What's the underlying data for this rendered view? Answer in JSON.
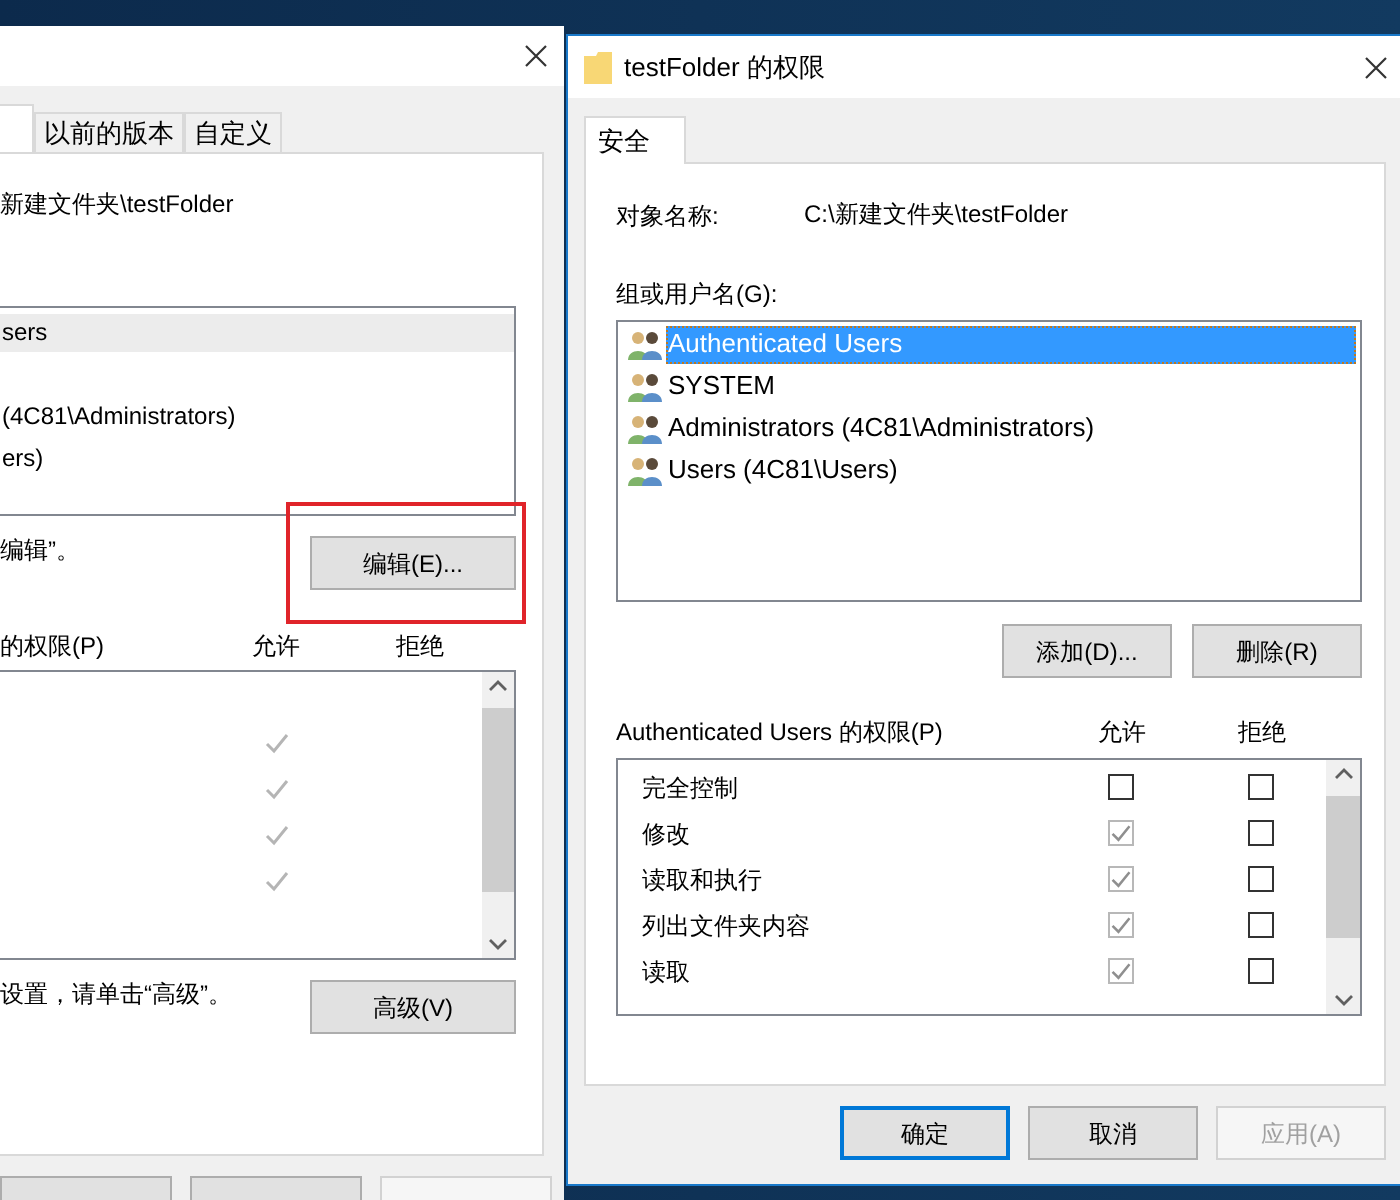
{
  "background_window": {
    "tabs": [
      {
        "selected": true
      },
      {
        "label": "以前的版本",
        "selected": false
      },
      {
        "label": "自定义",
        "selected": false
      }
    ],
    "object_path": "新建文件夹\\testFolder",
    "groups": [
      {
        "name": "sers",
        "selected": true
      },
      {
        "selected": false
      },
      {
        "name": "(4C81\\Administrators)",
        "selected": false
      },
      {
        "name": "ers)",
        "selected": false
      }
    ],
    "edit_hint": "编辑”。",
    "edit_button": {
      "label": "编辑(E)...",
      "highlighted": true
    },
    "permissions_header": "的权限(P)",
    "allow_header": "允许",
    "deny_header": "拒绝",
    "permissions": [
      {
        "allow": false
      },
      {
        "allow": true
      },
      {
        "allow": true
      },
      {
        "allow": true
      },
      {
        "allow": true
      }
    ],
    "advanced_hint": "设置，请单击“高级”。",
    "advanced_button": "高级(V)",
    "footer_buttons": [
      {
        "disabled": false
      },
      {
        "disabled": false
      },
      {
        "disabled": true
      }
    ]
  },
  "foreground_window": {
    "title": "testFolder 的权限",
    "tabs": [
      {
        "label": "安全",
        "selected": true
      }
    ],
    "object_name_label": "对象名称:",
    "object_name": "C:\\新建文件夹\\testFolder",
    "groups_label": "组或用户名(G):",
    "groups": [
      {
        "name": "Authenticated Users",
        "selected": true
      },
      {
        "name": "SYSTEM",
        "selected": false
      },
      {
        "name": "Administrators (4C81\\Administrators)",
        "selected": false
      },
      {
        "name": "Users (4C81\\Users)",
        "selected": false
      }
    ],
    "add_button": "添加(D)...",
    "remove_button": "删除(R)",
    "permissions_header": "Authenticated Users 的权限(P)",
    "allow_header": "允许",
    "deny_header": "拒绝",
    "permissions": [
      {
        "name": "完全控制",
        "allow": {
          "checked": false,
          "disabled": false
        },
        "deny": {
          "checked": false,
          "disabled": false
        }
      },
      {
        "name": "修改",
        "allow": {
          "checked": true,
          "disabled": true
        },
        "deny": {
          "checked": false,
          "disabled": false
        }
      },
      {
        "name": "读取和执行",
        "allow": {
          "checked": true,
          "disabled": true
        },
        "deny": {
          "checked": false,
          "disabled": false
        }
      },
      {
        "name": "列出文件夹内容",
        "allow": {
          "checked": true,
          "disabled": true
        },
        "deny": {
          "checked": false,
          "disabled": false
        }
      },
      {
        "name": "读取",
        "allow": {
          "checked": true,
          "disabled": true
        },
        "deny": {
          "checked": false,
          "disabled": false
        }
      }
    ],
    "buttons": [
      {
        "label": "确定",
        "default": true,
        "disabled": false
      },
      {
        "label": "取消",
        "default": false,
        "disabled": false
      },
      {
        "label": "应用(A)",
        "default": false,
        "disabled": true
      }
    ]
  }
}
